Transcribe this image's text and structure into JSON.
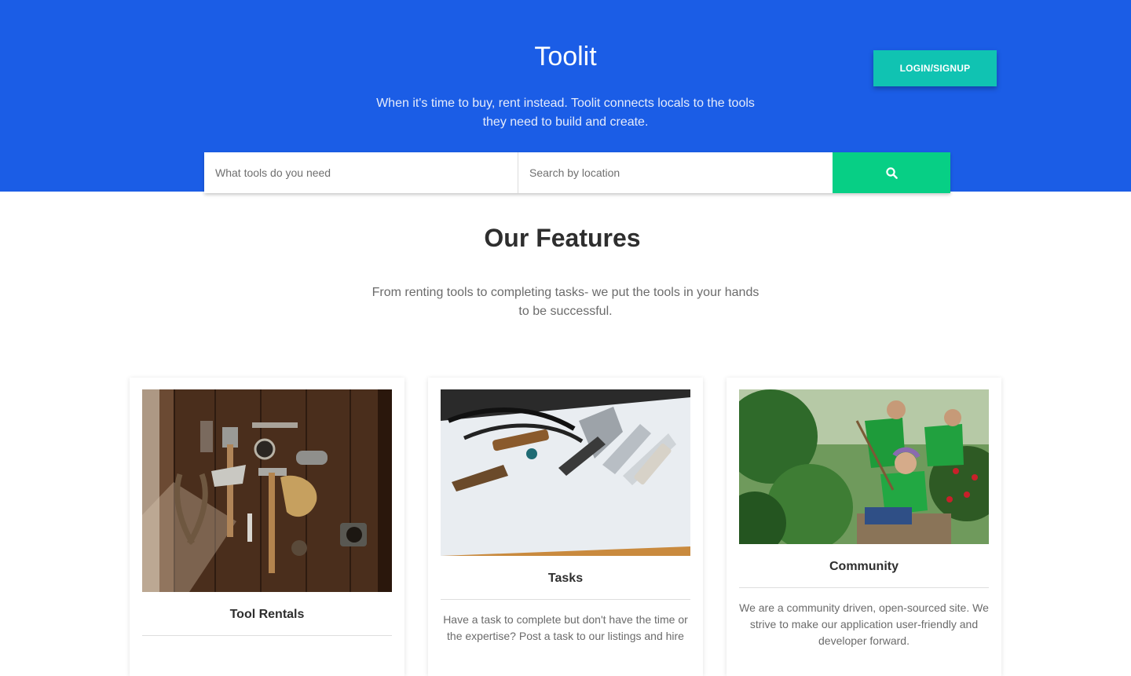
{
  "hero": {
    "brand": "Toolit",
    "tagline": "When it's time to buy, rent instead. Toolit connects locals to the tools they need to build and create.",
    "login_label": "LOGIN/SIGNUP",
    "search": {
      "tools_placeholder": "What tools do you need",
      "location_placeholder": "Search by location",
      "button_icon": "search-icon"
    }
  },
  "features": {
    "title": "Our Features",
    "subtitle": "From renting tools to completing tasks- we put the tools in your hands to be successful.",
    "cards": [
      {
        "title": "Tool Rentals",
        "text": "",
        "image": "hand-tools-on-wood-table"
      },
      {
        "title": "Tasks",
        "text": "Have a task to complete but don't have the time or the expertise? Post a task to our listings and hire",
        "image": "craft-tools-on-paper"
      },
      {
        "title": "Community",
        "text": "We are a community driven, open-sourced site. We strive to make our application user-friendly and developer forward.",
        "image": "volunteers-gardening"
      }
    ]
  },
  "colors": {
    "hero_bg": "#1b5de6",
    "login_button": "#10c3b2",
    "search_button": "#07cf85"
  }
}
